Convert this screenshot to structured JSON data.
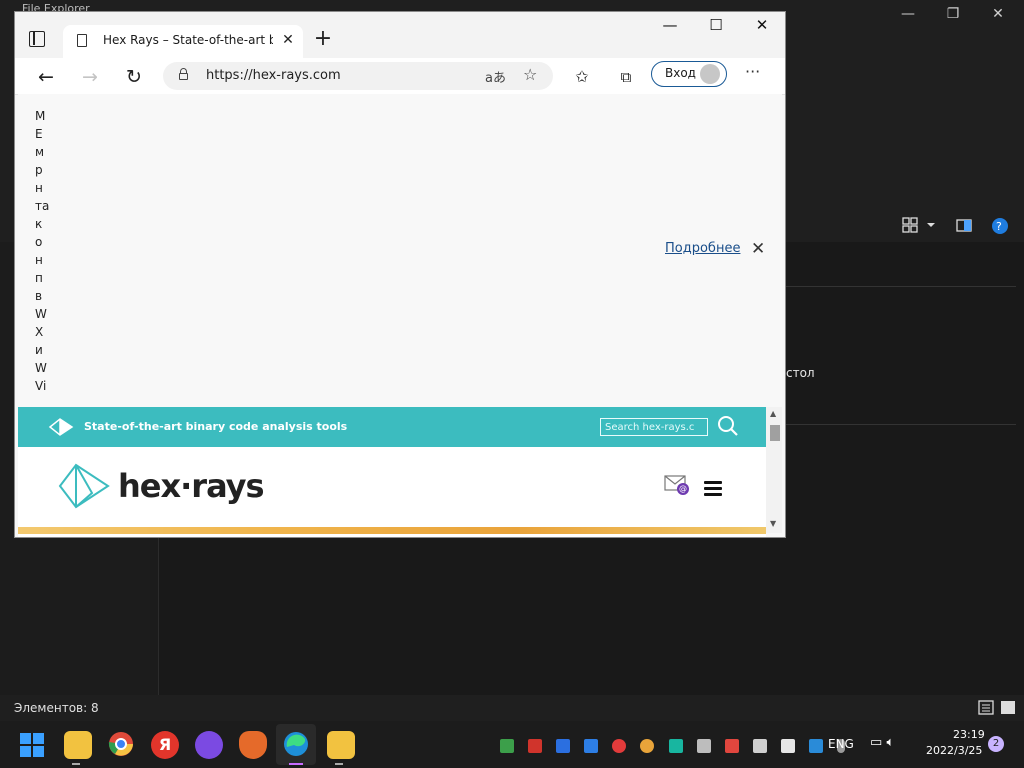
{
  "explorer": {
    "title": "File Explorer",
    "side_text": "стол",
    "status": "Элементов: 8",
    "win_controls": {
      "minimize": "—",
      "restore": "❐",
      "close": "✕"
    }
  },
  "edge": {
    "tab_title": "Hex Rays – State-of-the-art binar",
    "url": "https://hex-rays.com",
    "read_aloud": "aあ",
    "login_label": "Вход",
    "win_controls": {
      "minimize": "—",
      "maximize": "☐",
      "close": "✕"
    },
    "cookie_banner": {
      "words": [
        "M",
        "E",
        "м",
        "р",
        "н",
        "та",
        "к",
        "о",
        "н",
        "п",
        "в",
        "W",
        "X",
        "и",
        "W",
        "Vi"
      ],
      "more_link": "Подробнее",
      "close": "✕"
    }
  },
  "site": {
    "tagline": "State-of-the-art binary code analysis tools",
    "search_placeholder": "Search hex-rays.c",
    "logo_text": "hex·rays",
    "mail_badge": "@"
  },
  "taskbar": {
    "lang": "ENG",
    "time": "23:19",
    "date": "2022/3/25",
    "notifications": "2"
  },
  "colors": {
    "accent_teal": "#3cbcbf",
    "link_blue": "#1a4e8a",
    "edge_accent": "#c86bff"
  }
}
